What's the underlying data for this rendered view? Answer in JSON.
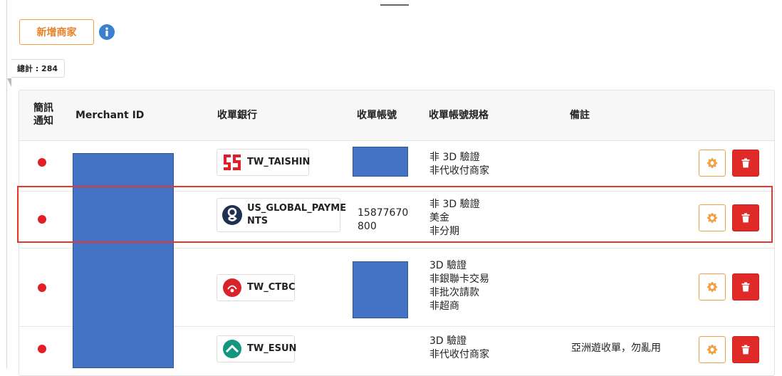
{
  "toolbar": {
    "add_merchant_label": "新增商家"
  },
  "summary": {
    "total_label": "總計 : 284"
  },
  "table": {
    "headers": {
      "sms_line1": "簡訊",
      "sms_line2": "通知",
      "merchant_id": "Merchant ID",
      "acquiring_bank": "收單銀行",
      "account_no": "收單帳號",
      "account_spec": "收單帳號規格",
      "note": "備註"
    },
    "rows": [
      {
        "bank_label": "TW_TAISHIN",
        "bank_icon": "taishin-logo-icon",
        "account_no_line1": "",
        "account_no_line2": "",
        "spec": [
          "非 3D 驗證",
          "非代收付商家"
        ],
        "note": ""
      },
      {
        "bank_label_line1": "US_GLOBAL_PAYME",
        "bank_label_line2": "NTS",
        "bank_icon": "global-payments-logo-icon",
        "account_no_line1": "15877670",
        "account_no_line2": "800",
        "spec": [
          "非 3D 驗證",
          "美金",
          "非分期"
        ],
        "note": ""
      },
      {
        "bank_label": "TW_CTBC",
        "bank_icon": "ctbc-logo-icon",
        "account_no_line1": "",
        "account_no_line2": "",
        "spec": [
          "3D 驗證",
          "非銀聯卡交易",
          "非批次請款",
          "非超商"
        ],
        "note": ""
      },
      {
        "bank_label": "TW_ESUN",
        "bank_icon": "esun-logo-icon",
        "account_no_line1": "",
        "account_no_line2": "",
        "spec": [
          "3D 驗證",
          "非代收付商家"
        ],
        "note": "亞洲遊收單，勿亂用"
      }
    ]
  },
  "colors": {
    "accent_orange": "#f0a047",
    "danger_red": "#e02a27",
    "status_dot": "#e21f25",
    "redaction_blue": "#4472c4",
    "highlight_border": "#e8382d"
  }
}
